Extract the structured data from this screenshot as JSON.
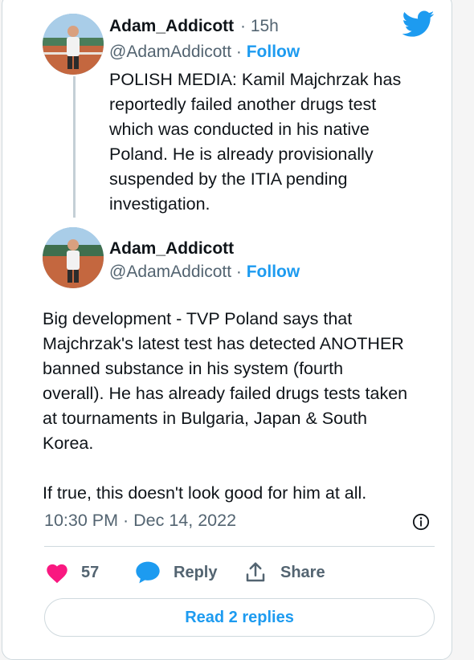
{
  "tweets": [
    {
      "display_name": "Adam_Addicott",
      "time": "15h",
      "handle": "@AdamAddicott",
      "follow_label": "Follow",
      "text_lines": [
        "POLISH MEDIA: Kamil Majchrzak has",
        "reportedly failed another drugs test",
        "which was conducted in his native",
        "Poland. He is already provisionally",
        "suspended by the ITIA pending",
        "investigation."
      ]
    },
    {
      "display_name": "Adam_Addicott",
      "handle": "@AdamAddicott",
      "follow_label": "Follow",
      "text_lines": [
        "Big development - TVP Poland says that",
        "Majchrzak's latest test has detected ANOTHER",
        "banned substance in his system (fourth",
        "overall). He has already failed drugs tests taken",
        "at tournaments in Bulgaria, Japan & South",
        "Korea."
      ],
      "text_line_extra": "If true, this doesn't look good for him at all.",
      "timestamp": "10:30 PM · Dec 14, 2022"
    }
  ],
  "actions": {
    "likes_count": "57",
    "reply_label": "Reply",
    "share_label": "Share"
  },
  "read_replies_label": "Read 2 replies",
  "colors": {
    "accent": "#1d9bf0",
    "like": "#f91880",
    "muted": "#536471"
  },
  "icons": [
    "twitter-bird-icon",
    "info-icon",
    "heart-icon",
    "reply-bubble-icon",
    "share-icon"
  ]
}
